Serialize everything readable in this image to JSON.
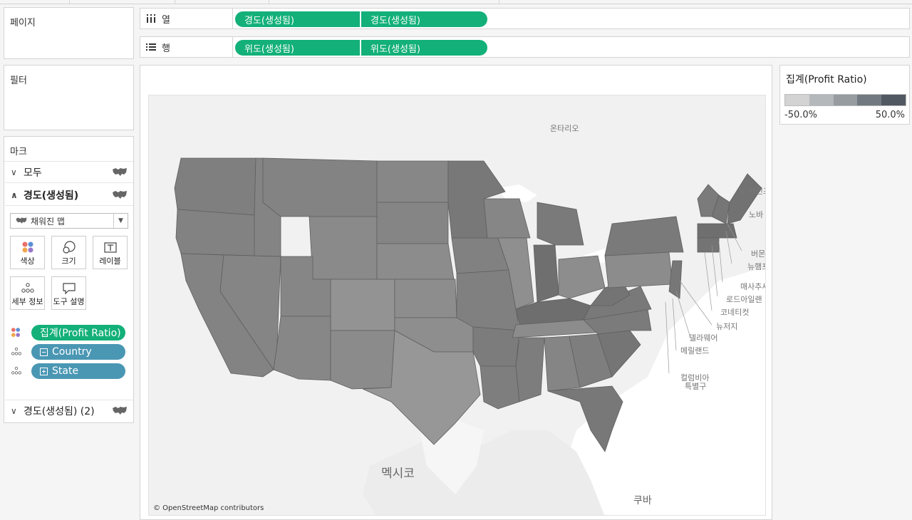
{
  "panels": {
    "pages": "페이지",
    "filters": "필터",
    "marks": "마크"
  },
  "shelves": {
    "columns_label": "열",
    "rows_label": "행",
    "columns_pills": [
      "경도(생성됨)",
      "경도(생성됨)"
    ],
    "rows_pills": [
      "위도(생성됨)",
      "위도(생성됨)"
    ]
  },
  "marks": {
    "all": "모두",
    "lon1": "경도(생성됨)",
    "lon2": "경도(생성됨) (2)",
    "mark_type": "채워진 맵",
    "buttons": {
      "color": "색상",
      "size": "크기",
      "label": "레이블",
      "detail": "세부 정보",
      "tooltip": "도구 설명"
    },
    "fields": [
      "집계(Profit Ratio)",
      "Country",
      "State"
    ]
  },
  "legend": {
    "title": "집계(Profit Ratio)",
    "min": "-50.0%",
    "max": "50.0%",
    "colors": [
      "#d3d3d3",
      "#b5b8ba",
      "#979ca0",
      "#727981",
      "#515862"
    ]
  },
  "map": {
    "attribution": "© OpenStreetMap contributors",
    "labels": {
      "ontario": "온타리오",
      "mexico": "멕시코",
      "cuba": "쿠바",
      "newbrunswick": "뉴\n브런즈윅",
      "novascotia": "노바",
      "vermont": "버몬",
      "newhampshire": "뉴햄프",
      "massachusetts": "매사추세",
      "rhodeisland": "로드아일랜",
      "connecticut": "코네티컷",
      "newjersey": "뉴저지",
      "delaware": "델라웨어",
      "maryland": "메릴랜드",
      "dc1": "컬럼비아",
      "dc2": "특별구"
    }
  }
}
